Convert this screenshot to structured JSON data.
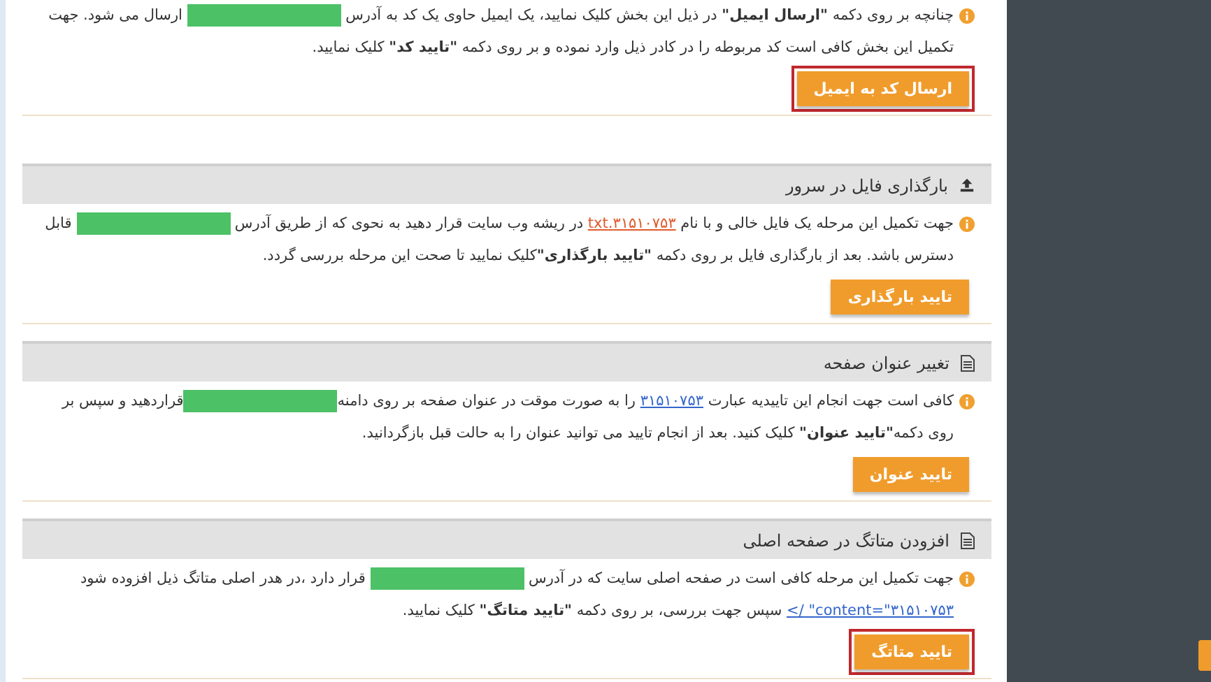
{
  "sections": [
    {
      "paragraph": [
        {
          "kind": "text",
          "text": "چنانچه بر روی دکمه "
        },
        {
          "kind": "bold",
          "text": "\"ارسال ایمیل\""
        },
        {
          "kind": "text",
          "text": " در ذیل این بخش کلیک نمایید، یک ایمیل حاوی یک کد به آدرس "
        },
        {
          "kind": "redacted"
        },
        {
          "kind": "text",
          "text": " ارسال می شود. جهت تکمیل این بخش کافی است کد مربوطه را در کادر ذیل وارد نموده و بر روی دکمه "
        },
        {
          "kind": "bold",
          "text": "\"تایید کد\""
        },
        {
          "kind": "text",
          "text": " کلیک نمایید."
        }
      ],
      "button": {
        "label": "ارسال کد به ایمیل",
        "highlighted": true
      }
    },
    {
      "title": "بارگذاری فایل در سرور",
      "kind": "upload",
      "paragraph": [
        {
          "kind": "text",
          "text": "جهت تکمیل این مرحله یک فایل خالی و با نام "
        },
        {
          "kind": "file-link",
          "text": "۳۱۵۱۰۷۵۳.txt"
        },
        {
          "kind": "text",
          "text": " در ریشه وب سایت قرار دهید به نحوی که از طریق آدرس "
        },
        {
          "kind": "redacted"
        },
        {
          "kind": "text",
          "text": " قابل دسترس باشد. بعد از بارگذاری فایل بر روی دکمه "
        },
        {
          "kind": "bold",
          "text": "\"تایید بارگذاری\""
        },
        {
          "kind": "text",
          "text": "کلیک نمایید تا صحت این مرحله بررسی گردد."
        }
      ],
      "button": {
        "label": "تایید بارگذاری",
        "highlighted": false
      }
    },
    {
      "title": "تغییر عنوان صفحه",
      "kind": "document",
      "paragraph": [
        {
          "kind": "text",
          "text": "کافی است جهت انجام این تاییدیه عبارت "
        },
        {
          "kind": "link",
          "text": "۳۱۵۱۰۷۵۳"
        },
        {
          "kind": "text",
          "text": " را به صورت موقت در عنوان صفحه بر روی دامنه"
        },
        {
          "kind": "redacted"
        },
        {
          "kind": "text",
          "text": "قراردهید و سپس بر روی دکمه"
        },
        {
          "kind": "bold",
          "text": "\"تایید عنوان\""
        },
        {
          "kind": "text",
          "text": " کلیک کنید. بعد از انجام تایید می توانید عنوان را به حالت قبل بازگردانید."
        }
      ],
      "button": {
        "label": "تایید عنوان",
        "highlighted": false
      }
    },
    {
      "title": "افزودن متاتگ در صفحه اصلی",
      "kind": "document",
      "paragraph": [
        {
          "kind": "text",
          "text": "جهت تکمیل این مرحله کافی است در صفحه اصلی سایت که در آدرس "
        },
        {
          "kind": "redacted"
        },
        {
          "kind": "text",
          "text": " قرار دارد ،در هدر اصلی متاتگ ذیل افزوده شود "
        },
        {
          "kind": "link",
          "text": "content=\"۳۱۵۱۰۷۵۳\" />"
        },
        {
          "kind": "text",
          "text": " سپس جهت بررسی، بر روی دکمه "
        },
        {
          "kind": "bold",
          "text": "\"تایید متاتگ\""
        },
        {
          "kind": "text",
          "text": " کلیک نمایید."
        }
      ],
      "button": {
        "label": "تایید متاتگ",
        "highlighted": true
      }
    }
  ]
}
